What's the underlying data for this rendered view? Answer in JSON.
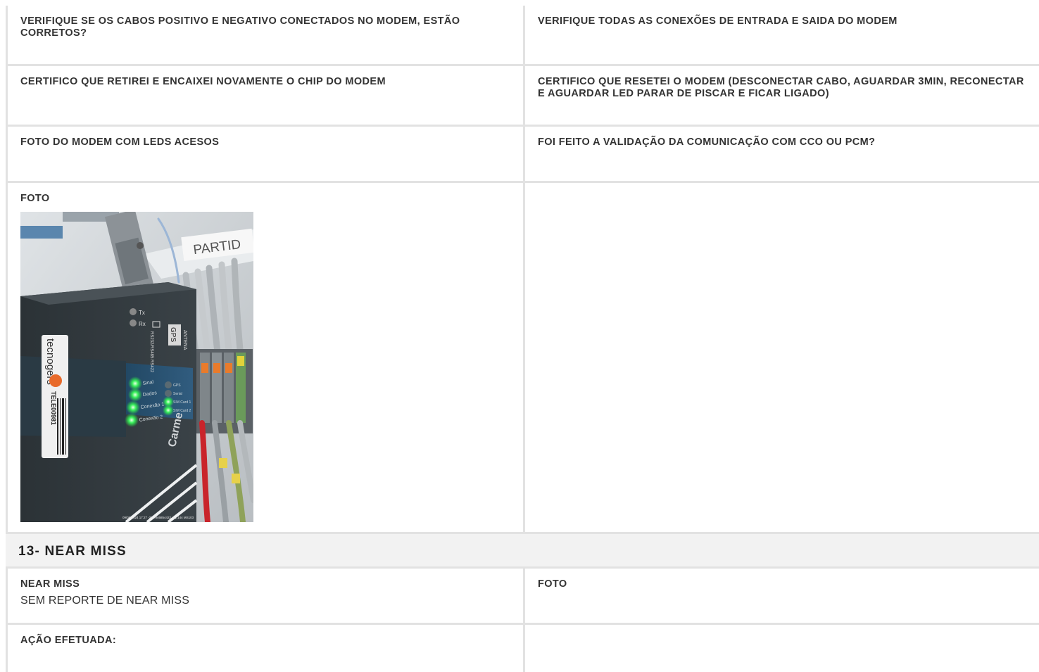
{
  "rows": [
    {
      "left": {
        "label": "VERIFIQUE SE OS CABOS POSITIVO E NEGATIVO CONECTADOS NO MODEM, ESTÃO CORRETOS?"
      },
      "right": {
        "label": "VERIFIQUE TODAS AS CONEXÕES DE ENTRADA E SAIDA DO MODEM"
      }
    },
    {
      "left": {
        "label": "CERTIFICO QUE RETIREI E ENCAIXEI NOVAMENTE O CHIP DO MODEM"
      },
      "right": {
        "label": "CERTIFICO QUE RESETEI O MODEM (DESCONECTAR CABO, AGUARDAR 3MIN, RECONECTAR E AGUARDAR LED PARAR DE PISCAR E FICAR LIGADO)"
      }
    },
    {
      "left": {
        "label": "FOTO DO MODEM COM LEDS ACESOS"
      },
      "right": {
        "label": "FOI FEITO A VALIDAÇÃO DA COMUNICAÇÃO COM CCO OU PCM?"
      }
    },
    {
      "left": {
        "label": "FOTO"
      },
      "right": {
        "label": ""
      }
    }
  ],
  "photo": {
    "label_strip": "PARTID",
    "brand_sticker": "tecnogers",
    "barcode_text": "TELE00981",
    "brand_logo": "Carme",
    "leds": [
      "Sinal",
      "Dados",
      "Conexão 1",
      "Conexão 2"
    ],
    "leds_right": [
      "GPS",
      "Serial",
      "SIM Card 1",
      "SIM Card 2"
    ],
    "port_labels": [
      "Tx",
      "Rx"
    ],
    "port_name": "RS232/RS485 RS422",
    "gps_label": "GPS",
    "ant_label": "ANTENA",
    "timestamp": "09/05/2024 17:27 -23.7846854422 -51.144 MS103"
  },
  "section": {
    "title": "13- NEAR MISS"
  },
  "near_miss": {
    "left": {
      "label": "NEAR MISS",
      "value": "SEM REPORTE DE NEAR MISS"
    },
    "right": {
      "label": "FOTO"
    }
  },
  "action": {
    "left": {
      "label": "AÇÃO EFETUADA:"
    },
    "right": {
      "label": ""
    }
  }
}
